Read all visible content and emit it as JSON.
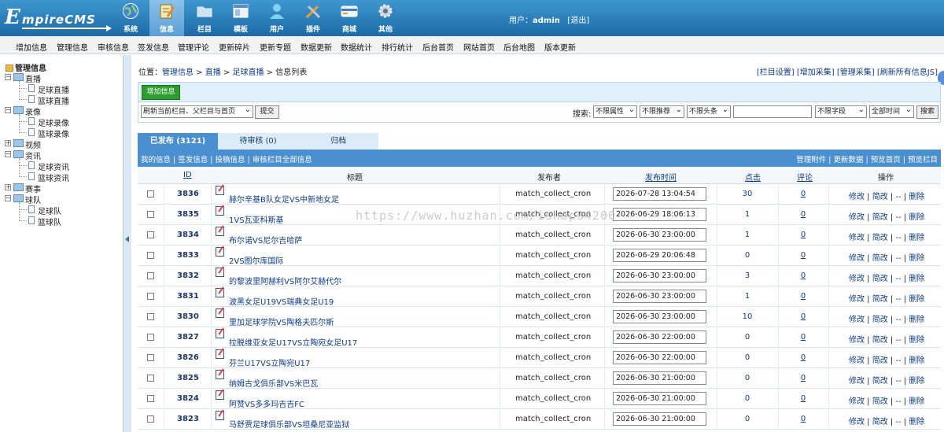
{
  "logo": {
    "first": "E",
    "rest": "mpireCMS"
  },
  "top_nav": [
    {
      "label": "系统",
      "icon": "globe-icon"
    },
    {
      "label": "信息",
      "icon": "notepad-icon"
    },
    {
      "label": "栏目",
      "icon": "folder-icon"
    },
    {
      "label": "模板",
      "icon": "window-icon"
    },
    {
      "label": "用户",
      "icon": "user-icon"
    },
    {
      "label": "插件",
      "icon": "tools-icon"
    },
    {
      "label": "商城",
      "icon": "card-icon"
    },
    {
      "label": "其他",
      "icon": "gear-icon"
    }
  ],
  "user": {
    "prefix": "用户：",
    "name": "admin",
    "logout": "[退出]"
  },
  "sub_menu": [
    "增加信息",
    "管理信息",
    "审核信息",
    "签发信息",
    "管理评论",
    "更新碎片",
    "更新专题",
    "数据更新",
    "数据统计",
    "排行统计",
    "后台首页",
    "网站首页",
    "后台地图",
    "版本更新"
  ],
  "tree": {
    "root": "管理信息",
    "nodes": [
      {
        "label": "直播",
        "children": [
          "足球直播",
          "篮球直播"
        ]
      },
      {
        "label": "录像",
        "children": [
          "足球录像",
          "篮球录像"
        ]
      },
      {
        "label": "视频",
        "children": []
      },
      {
        "label": "资讯",
        "children": [
          "足球资讯",
          "篮球资讯"
        ]
      },
      {
        "label": "赛事",
        "children": []
      },
      {
        "label": "球队",
        "children": [
          "足球队",
          "篮球队"
        ]
      }
    ]
  },
  "breadcrumb": {
    "prefix": "位置：",
    "items": [
      "管理信息",
      "直播",
      "足球直播"
    ],
    "current": "信息列表"
  },
  "top_links": [
    "[栏目设置]",
    "[增加采集]",
    "[管理采集]",
    "[刷新所有信息JS]"
  ],
  "toolbar": {
    "add_label": "增加信息",
    "refresh_select": "刷新当前栏目、父栏目与首页",
    "submit_label": "提交",
    "search_label": "搜索:",
    "filters": [
      "不限属性",
      "不限推荐",
      "不限头条"
    ],
    "field_select": "不限字段",
    "time_select": "全部时间",
    "search_button": "搜索"
  },
  "tabs": [
    {
      "label": "已发布 (3121)",
      "active": true
    },
    {
      "label": "待审核 (0)",
      "active": false
    },
    {
      "label": "归档",
      "active": false
    }
  ],
  "link_bar": {
    "left": [
      "我的信息",
      "签发信息",
      "投稿信息",
      "审核栏目全部信息"
    ],
    "right": [
      "管理附件",
      "更新数据",
      "预览首页",
      "预览栏目"
    ]
  },
  "columns": {
    "id": "ID",
    "title": "标题",
    "publisher": "发布者",
    "time": "发布时间",
    "clicks": "点击",
    "comments": "评论",
    "ops": "操作"
  },
  "row_actions": [
    "修改",
    "简改",
    "--",
    "删除"
  ],
  "rows": [
    {
      "id": "3836",
      "title": "赫尔辛基B队女足VS中新地女足",
      "publisher": "match_collect_cron",
      "time": "2026-07-28 13:04:54",
      "clicks": "30",
      "comments": "0"
    },
    {
      "id": "3835",
      "title": "1VS瓦亚科斯基",
      "publisher": "match_collect_cron",
      "time": "2026-06-29 18:06:13",
      "clicks": "1",
      "comments": "0"
    },
    {
      "id": "3834",
      "title": "布尔诺VS尼尔吉哈萨",
      "publisher": "match_collect_cron",
      "time": "2026-06-30 23:00:00",
      "clicks": "1",
      "comments": "0"
    },
    {
      "id": "3833",
      "title": "2VS图尔库国际",
      "publisher": "match_collect_cron",
      "time": "2026-06-29 20:06:48",
      "clicks": "0",
      "comments": "0"
    },
    {
      "id": "3832",
      "title": "的黎波里阿赫利VS阿尔艾赫代尔",
      "publisher": "match_collect_cron",
      "time": "2026-06-30 23:00:00",
      "clicks": "3",
      "comments": "0"
    },
    {
      "id": "3831",
      "title": "波黑女足U19VS瑞典女足U19",
      "publisher": "match_collect_cron",
      "time": "2026-06-30 23:00:00",
      "clicks": "1",
      "comments": "0"
    },
    {
      "id": "3830",
      "title": "里加足球学院VS陶格夫匹尔斯",
      "publisher": "match_collect_cron",
      "time": "2026-06-30 23:00:00",
      "clicks": "10",
      "comments": "0"
    },
    {
      "id": "3827",
      "title": "拉脱维亚女足U17VS立陶宛女足U17",
      "publisher": "match_collect_cron",
      "time": "2026-06-30 22:00:00",
      "clicks": "0",
      "comments": "0"
    },
    {
      "id": "3826",
      "title": "芬兰U17VS立陶宛U17",
      "publisher": "match_collect_cron",
      "time": "2026-06-30 22:00:00",
      "clicks": "0",
      "comments": "0"
    },
    {
      "id": "3825",
      "title": "纳姆古戈俱乐部VS米巴瓦",
      "publisher": "match_collect_cron",
      "time": "2026-06-30 21:00:00",
      "clicks": "0",
      "comments": "0"
    },
    {
      "id": "3824",
      "title": "阿赞VS多多玛吉吉FC",
      "publisher": "match_collect_cron",
      "time": "2026-06-30 21:00:00",
      "clicks": "0",
      "comments": "0"
    },
    {
      "id": "3823",
      "title": "马舒贾足球俱乐部VS坦桑尼亚监狱",
      "publisher": "match_collect_cron",
      "time": "2026-06-30 21:00:00",
      "clicks": "0",
      "comments": "0"
    }
  ],
  "watermark": "https://www.huzhan.com/ishop34200"
}
